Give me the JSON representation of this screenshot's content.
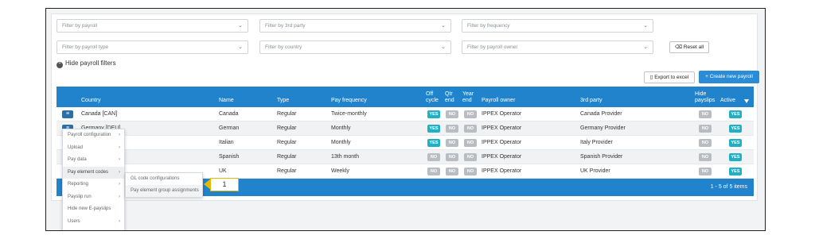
{
  "filters": [
    {
      "placeholder": "Filter by payroll"
    },
    {
      "placeholder": "Filter by 3rd party"
    },
    {
      "placeholder": "Filter by frequency"
    },
    {
      "placeholder": "Filter by payroll type"
    },
    {
      "placeholder": "Filter by country"
    },
    {
      "placeholder": "Filter by payroll owner"
    }
  ],
  "reset_label": "Reset all",
  "hide_filters_label": "Hide payroll filters",
  "export_label": "Export to excel",
  "create_label": "+ Create new payroll",
  "columns": [
    "Country",
    "Name",
    "Type",
    "Pay frequency",
    "Off cycle",
    "Qtr end",
    "Year end",
    "Payroll owner",
    "3rd party",
    "Hide payslips",
    "Active"
  ],
  "rows": [
    {
      "country": "Canada [CAN]",
      "name": "Canada",
      "type": "Regular",
      "freq": "Twice-monthly",
      "off": "YES",
      "qtr": "NO",
      "year": "NO",
      "owner": "IPPEX Operator",
      "third": "Canada Provider",
      "hide": "NO",
      "active": "YES"
    },
    {
      "country": "Germany [DEU]",
      "name": "German",
      "type": "Regular",
      "freq": "Monthly",
      "off": "YES",
      "qtr": "NO",
      "year": "NO",
      "owner": "IPPEX Operator",
      "third": "Germany Provider",
      "hide": "NO",
      "active": "YES"
    },
    {
      "country": "",
      "name": "Italian",
      "type": "Regular",
      "freq": "Monthly",
      "off": "YES",
      "qtr": "NO",
      "year": "NO",
      "owner": "IPPEX Operator",
      "third": "Italy Provider",
      "hide": "NO",
      "active": "YES"
    },
    {
      "country": "",
      "name": "Spanish",
      "type": "Regular",
      "freq": "13th month",
      "off": "NO",
      "qtr": "NO",
      "year": "NO",
      "owner": "IPPEX Operator",
      "third": "Spanish Provider",
      "hide": "NO",
      "active": "YES"
    },
    {
      "country": "",
      "name": "UK",
      "type": "Regular",
      "freq": "Weekly",
      "off": "NO",
      "qtr": "NO",
      "year": "NO",
      "owner": "IPPEX Operator",
      "third": "UK Provider",
      "hide": "NO",
      "active": "YES"
    }
  ],
  "pagination_text": "1 - 5 of 5 items",
  "menu_items": [
    {
      "label": "Payroll configuration",
      "has_sub": true
    },
    {
      "label": "Upload",
      "has_sub": true
    },
    {
      "label": "Pay data",
      "has_sub": true
    },
    {
      "label": "Pay element codes",
      "has_sub": true
    },
    {
      "label": "Reporting",
      "has_sub": true
    },
    {
      "label": "Payslip run",
      "has_sub": true
    },
    {
      "label": "Hide new E-payslips",
      "has_sub": false
    },
    {
      "label": "Users",
      "has_sub": true
    }
  ],
  "submenu_items": [
    "GL code configurations",
    "Pay element group assignments"
  ],
  "callout_number": "1",
  "colors": {
    "header_blue": "#2083cc",
    "yes_badge": "#20b0c6",
    "no_badge": "#b9bdc2",
    "callout": "#e6b800"
  }
}
